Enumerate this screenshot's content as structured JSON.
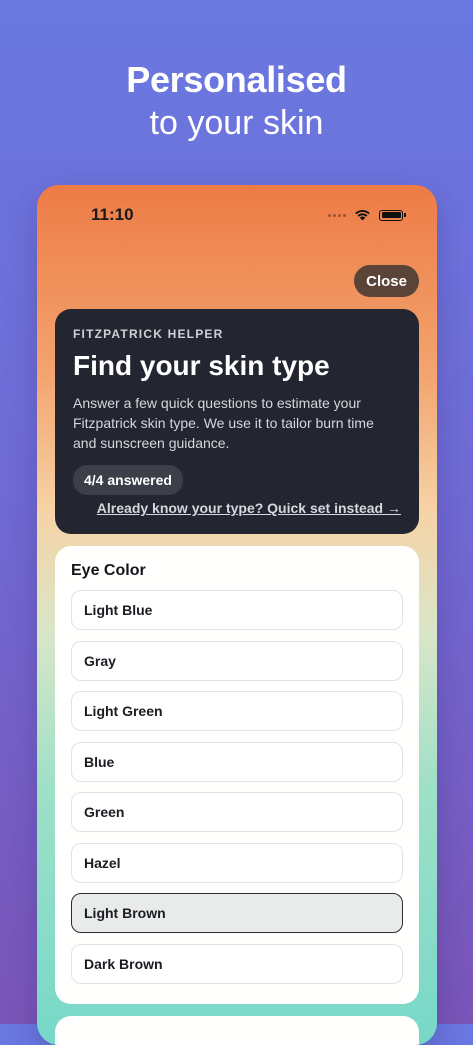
{
  "promo": {
    "line1": "Personalised",
    "line2": "to your skin"
  },
  "status": {
    "time": "11:10"
  },
  "header": {
    "close_label": "Close"
  },
  "hero": {
    "eyebrow": "FITZPATRICK HELPER",
    "title": "Find your skin type",
    "description": "Answer a few quick questions to estimate your Fitzpatrick skin type. We use it to tailor burn time and sunscreen guidance.",
    "progress_badge": "4/4 answered",
    "quick_set_link": "Already know your type? Quick set instead →"
  },
  "question": {
    "title": "Eye Color",
    "options": [
      {
        "label": "Light Blue"
      },
      {
        "label": "Gray"
      },
      {
        "label": "Light Green"
      },
      {
        "label": "Blue"
      },
      {
        "label": "Green"
      },
      {
        "label": "Hazel"
      },
      {
        "label": "Light Brown",
        "selected": true
      },
      {
        "label": "Dark Brown"
      }
    ]
  }
}
